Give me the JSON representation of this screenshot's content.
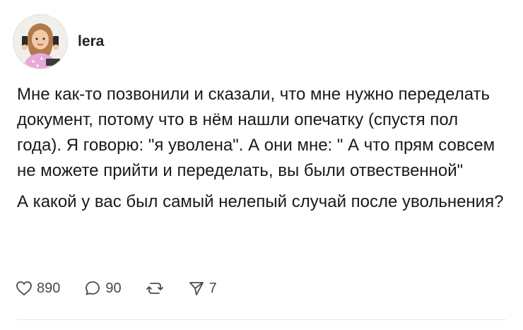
{
  "post": {
    "author": "lera",
    "paragraphs": [
      "Мне как-то позвонили и сказали, что мне нужно переделать документ, потому что в нём нашли опечатку (спустя пол года). Я говорю: \"я уволена\". А они мне: \" А что прям совсем не можете прийти и переделать, вы были отвественной\"",
      "А какой у вас был самый нелепый случай после увольнения?"
    ]
  },
  "actions": {
    "likes": "890",
    "comments": "90",
    "shares": "7"
  },
  "icons": {
    "like": "heart-icon",
    "comment": "comment-bubble-icon",
    "repost": "repost-icon",
    "share": "send-icon"
  }
}
